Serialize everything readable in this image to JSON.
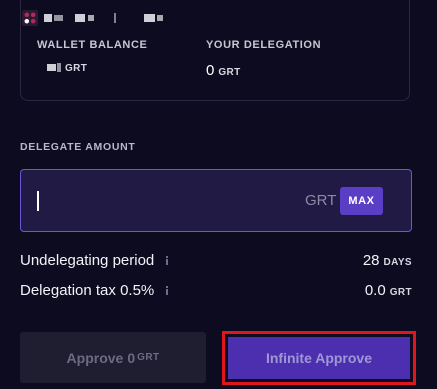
{
  "wallet": {
    "balance_label": "WALLET BALANCE",
    "balance_unit": "GRT",
    "delegation_label": "YOUR DELEGATION",
    "delegation_value": "0",
    "delegation_unit": "GRT"
  },
  "delegate": {
    "section_label": "DELEGATE AMOUNT",
    "input_value": "",
    "unit": "GRT",
    "max_label": "MAX"
  },
  "info": {
    "undelegating_label": "Undelegating period",
    "undelegating_value": "28",
    "undelegating_unit": "DAYS",
    "tax_label": "Delegation tax 0.5%",
    "tax_value": "0.0",
    "tax_unit": "GRT"
  },
  "actions": {
    "approve_label": "Approve",
    "approve_value": "0",
    "approve_unit": "GRT",
    "infinite_label": "Infinite Approve"
  },
  "colors": {
    "background": "#0d0b1f",
    "accent": "#5a3fc6",
    "highlight": "#e0161c"
  }
}
